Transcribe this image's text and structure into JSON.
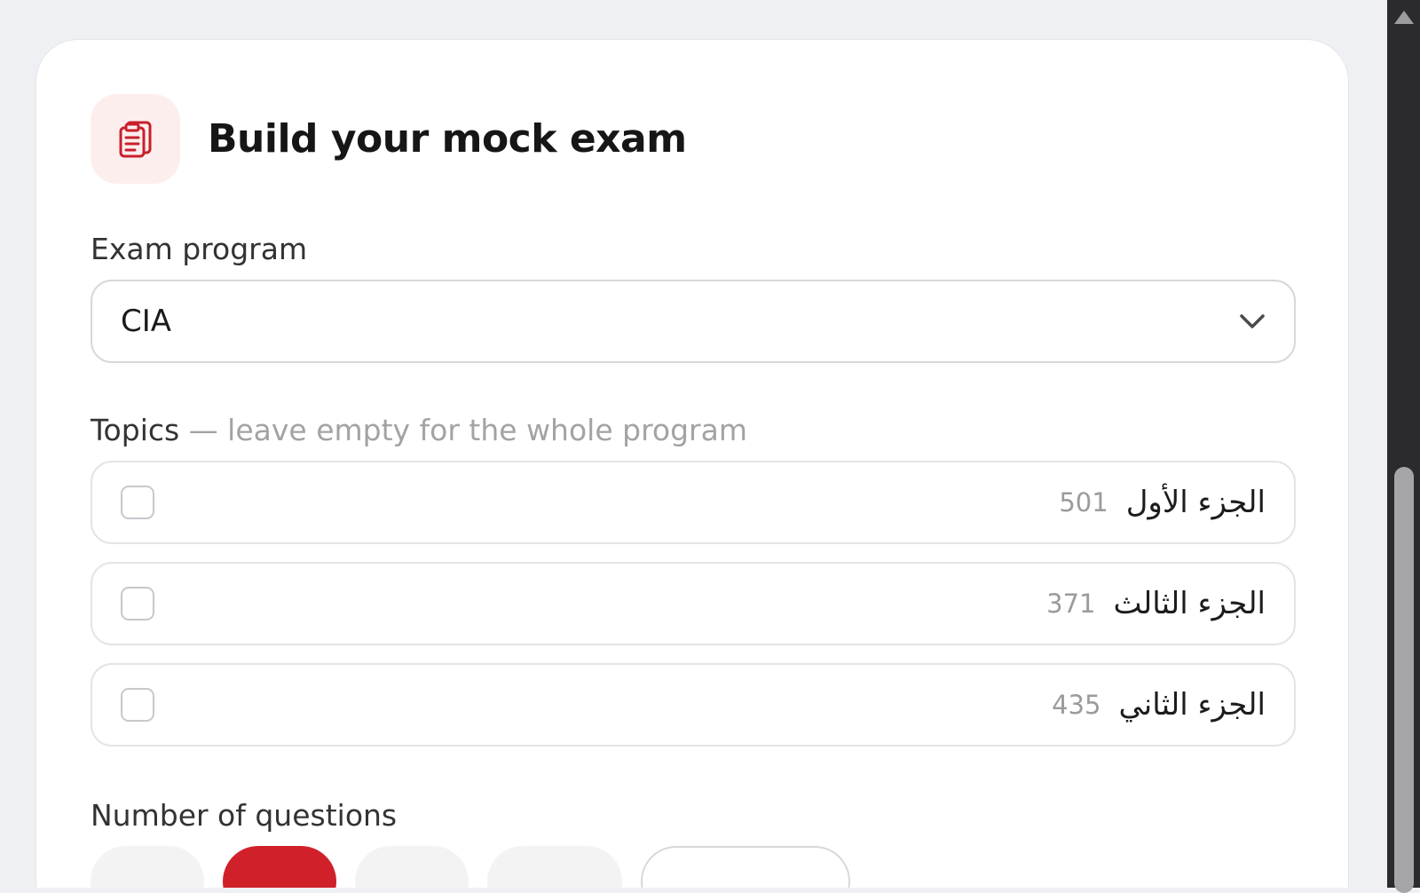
{
  "header": {
    "icon": "clipboard-icon",
    "title": "Build your mock exam"
  },
  "program": {
    "label": "Exam program",
    "selected": "CIA"
  },
  "topics": {
    "label": "Topics",
    "hint": " — leave empty for the whole program",
    "items": [
      {
        "name": "الجزء الأول",
        "count": "501",
        "checked": false
      },
      {
        "name": "الجزء الثالث",
        "count": "371",
        "checked": false
      },
      {
        "name": "الجزء الثاني",
        "count": "435",
        "checked": false
      }
    ]
  },
  "questions": {
    "label": "Number of questions"
  },
  "colors": {
    "accent": "#d0202a",
    "icon_bg": "#fdeeee"
  }
}
